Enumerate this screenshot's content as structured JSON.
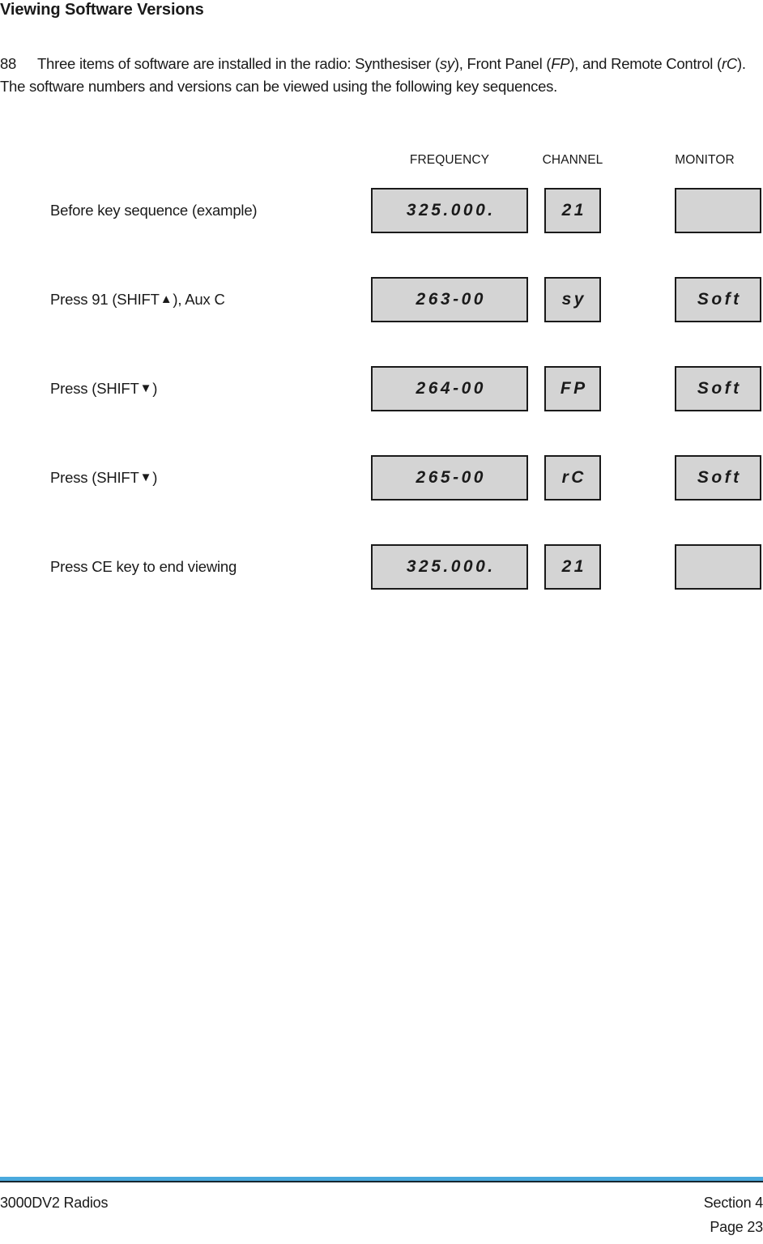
{
  "document": {
    "title": "Viewing Software Versions",
    "intro": {
      "number": "88",
      "part1": "Three items of software are installed in the radio: Synthesiser (",
      "em1": "sy",
      "part2": "), Front Panel (",
      "em2": "FP",
      "part3": "), and Remote Control (",
      "em3": "rC",
      "part4": "). The software numbers and versions can be viewed using the following key sequences."
    }
  },
  "table": {
    "headers": {
      "frequency": "FREQUENCY",
      "channel": "CHANNEL",
      "monitor": "MONITOR"
    },
    "rows": [
      {
        "label_pre": "Before key sequence (example)",
        "label_triangle": "",
        "label_post": "",
        "frequency": "325.000.",
        "channel": "21",
        "monitor": ""
      },
      {
        "label_pre": "Press 91 (SHIFT ",
        "label_triangle": "▲",
        "label_post": "), Aux C",
        "frequency": "263-00",
        "channel": "sy",
        "monitor": "Soft"
      },
      {
        "label_pre": "Press (SHIFT ",
        "label_triangle": "▼",
        "label_post": ")",
        "frequency": "264-00",
        "channel": "FP",
        "monitor": "Soft"
      },
      {
        "label_pre": "Press (SHIFT ",
        "label_triangle": "▼",
        "label_post": ")",
        "frequency": "265-00",
        "channel": "rC",
        "monitor": "Soft"
      },
      {
        "label_pre": "Press CE key to end viewing",
        "label_triangle": "",
        "label_post": "",
        "frequency": "325.000.",
        "channel": "21",
        "monitor": ""
      }
    ]
  },
  "footer": {
    "left": "3000DV2 Radios",
    "section": "Section 4",
    "page": "Page 23",
    "rule_color": "#4aa9dd"
  }
}
